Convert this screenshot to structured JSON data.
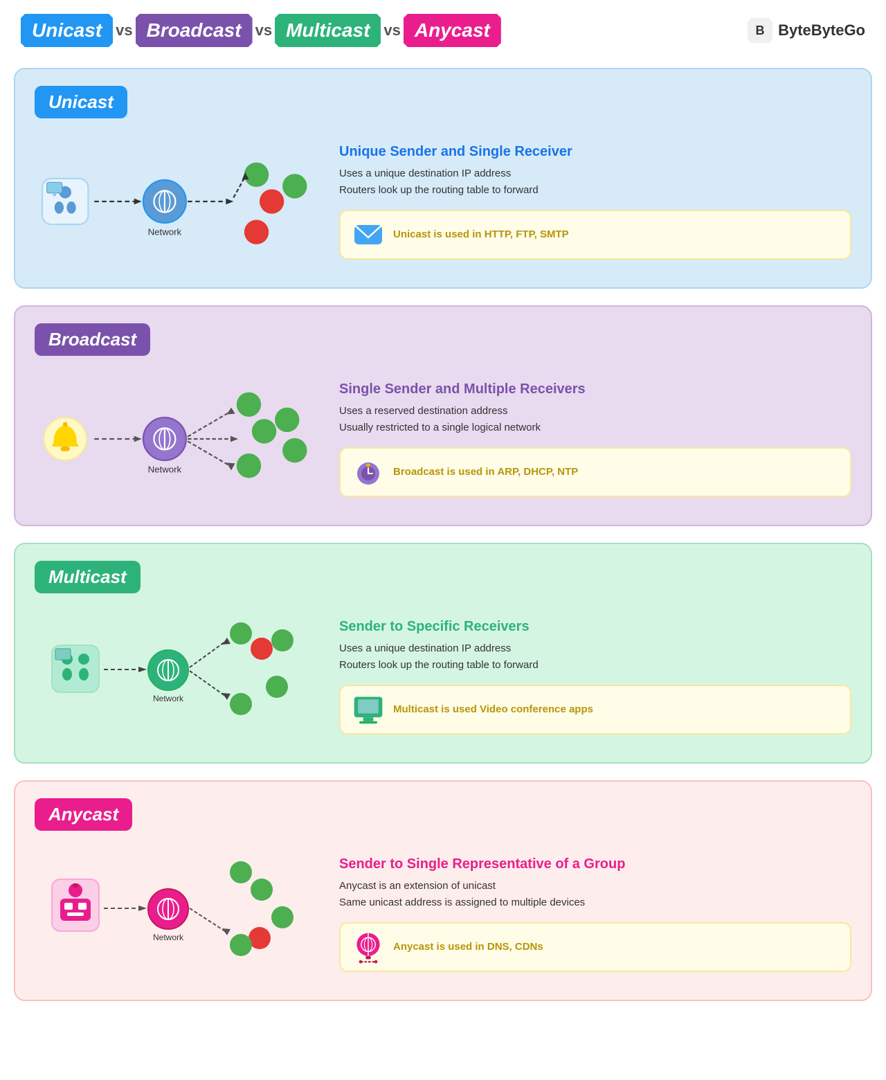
{
  "header": {
    "title": "Unicast vs Broadcast vs Multicast vs Anycast",
    "badges": [
      {
        "label": "Unicast",
        "color": "#2196F3"
      },
      {
        "label": "Broadcast",
        "color": "#7B52AB"
      },
      {
        "label": "Multicast",
        "color": "#2DB37A"
      },
      {
        "label": "Anycast",
        "color": "#E91E8C"
      }
    ],
    "vs_label": "vs",
    "brand_name": "ByteByteGo"
  },
  "sections": [
    {
      "id": "unicast",
      "title": "Unicast",
      "title_color": "#2196F3",
      "bg_color": "#D6EAF8",
      "info_title": "Unique Sender and Single Receiver",
      "info_title_color": "#1A73E8",
      "desc_line1": "Uses a unique destination IP address",
      "desc_line2": "Routers look up the routing table to forward",
      "use_case": "Unicast is used in HTTP, FTP, SMTP",
      "network_label": "Network"
    },
    {
      "id": "broadcast",
      "title": "Broadcast",
      "title_color": "#7B52AB",
      "bg_color": "#E8DAEF",
      "info_title": "Single Sender and Multiple Receivers",
      "info_title_color": "#7B52AB",
      "desc_line1": "Uses a reserved destination address",
      "desc_line2": "Usually restricted to a single logical network",
      "use_case": "Broadcast is used in ARP, DHCP, NTP",
      "network_label": "Network"
    },
    {
      "id": "multicast",
      "title": "Multicast",
      "title_color": "#2DB37A",
      "bg_color": "#D5F5E3",
      "info_title": "Sender to Specific Receivers",
      "info_title_color": "#2DB37A",
      "desc_line1": "Uses a unique destination IP address",
      "desc_line2": "Routers look up the routing table to forward",
      "use_case": "Multicast is used Video conference apps",
      "network_label": "Network"
    },
    {
      "id": "anycast",
      "title": "Anycast",
      "title_color": "#E91E8C",
      "bg_color": "#FDEDEC",
      "info_title": "Sender to Single Representative of a Group",
      "info_title_color": "#E91E8C",
      "desc_line1": "Anycast is an extension of unicast",
      "desc_line2": "Same unicast address is assigned to multiple devices",
      "use_case": "Anycast is used in DNS, CDNs",
      "network_label": "Network"
    }
  ]
}
